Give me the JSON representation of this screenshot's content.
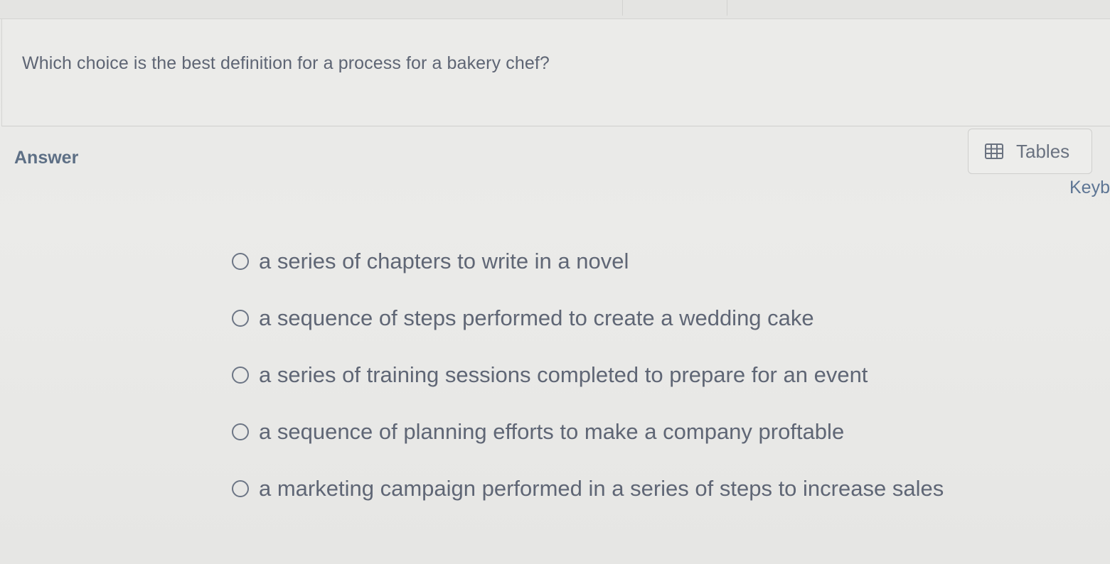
{
  "question": {
    "text": "Which choice is the best definition for a process for a bakery chef?"
  },
  "answer": {
    "label": "Answer"
  },
  "toolbar": {
    "tables_label": "Tables",
    "tables_icon": "table-grid-icon",
    "keyboard_link": "Keyb"
  },
  "options": [
    {
      "label": "a series of chapters to write in a novel",
      "selected": false
    },
    {
      "label": "a sequence of steps performed to create a wedding cake",
      "selected": false
    },
    {
      "label": "a series of training sessions completed to prepare for an event",
      "selected": false
    },
    {
      "label": "a sequence of planning efforts to make a company proftable",
      "selected": false
    },
    {
      "label": "a marketing campaign performed in a series of steps to increase sales",
      "selected": false
    }
  ],
  "colors": {
    "background": "#e9e9e7",
    "text": "#5f6675",
    "answer_label": "#5d6f85",
    "link": "#5d7594"
  }
}
